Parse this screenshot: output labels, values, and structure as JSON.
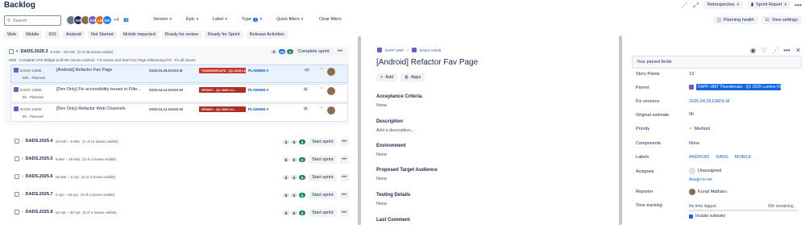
{
  "header": {
    "title": "Backlog",
    "retrospective": "Retrospective",
    "sprint_report": "Sprint Report"
  },
  "filters": {
    "search_placeholder": "Search",
    "avatars": [
      {
        "initials": "",
        "color": "#6b778c"
      },
      {
        "initials": "DS",
        "color": "#1d2b4f"
      },
      {
        "initials": "",
        "color": "#8c6b4f"
      },
      {
        "initials": "KG",
        "color": "#6e5dc6"
      },
      {
        "initials": "LN",
        "color": "#e56910"
      },
      {
        "initials": "MS",
        "color": "#1d7afc"
      }
    ],
    "avatars_more": "+4",
    "version": "Version",
    "epic": "Epic",
    "label": "Label",
    "type": "Type",
    "type_count": "1",
    "quick_filters": "Quick filters",
    "clear_filters": "Clear filters",
    "planning_health": "Planning health",
    "view_settings": "View settings"
  },
  "chips": [
    "Web",
    "Mobile",
    "IOS",
    "Android",
    "Not Started",
    "Mobile impacted",
    "Ready for review",
    "Ready for Sprint",
    "Release Activities"
  ],
  "active_sprint": {
    "name": "DADS.2025.3",
    "dates": "5 Feb – 19 Feb",
    "visible": "(3 of 36 issues visible)",
    "counts": [
      "0",
      "26",
      "0"
    ],
    "complete_label": "Complete sprint",
    "goal": "Web - Complete LPS Widget & all WA issues Android - Fix Issues and Start Fav Page refactoring iOS - Fix all issues",
    "issues": [
      {
        "key": "DADS-14036",
        "summary": "[Android] Refactor Fav Page",
        "estimate": "60h - Planned",
        "fix": "2025.04.28.DADS.M",
        "epic": "THUNDERCATS - Q1 2025 LU...",
        "epic_color": "#c9372c",
        "status": "PLANNED",
        "points": "13"
      },
      {
        "key": "DADS-13958",
        "summary": "[Dev Only] Fix accessibility issues in Filte...",
        "estimate": "8h - Planned",
        "fix": "2025.04.13.DADS.W",
        "epic": "SPIDEY - Q1 2025 LU...",
        "epic_color": "#ae2e24",
        "status": "PLANNED",
        "points": "8"
      },
      {
        "key": "DADS-14046",
        "summary": "[Dev Only] Refactor Web Channels",
        "estimate": "8h - Planned",
        "fix": "2025.04.13.DADS.W",
        "epic": "SPIDEY - Q1 2025 LU...",
        "epic_color": "#ae2e24",
        "status": "PLANNED",
        "points": "8"
      }
    ]
  },
  "sprints": [
    {
      "name": "DADS.2025.4",
      "dates": "19 Feb – 5 Mar",
      "visible": "(1 of 13 issues visible)",
      "counts": [
        "3",
        "0",
        "0"
      ],
      "action": "Start sprint"
    },
    {
      "name": "DADS.2025.5",
      "dates": "5 Mar – 19 Mar",
      "visible": "(0 of 4 issues visible)",
      "counts": [
        "0",
        "0",
        "0"
      ],
      "action": "Start sprint"
    },
    {
      "name": "DADS.2025.6",
      "dates": "19 Mar – 2 Apr",
      "visible": "(0 of 4 issues visible)",
      "counts": [
        "0",
        "0",
        "0"
      ],
      "action": "Start sprint"
    },
    {
      "name": "DADS.2025.7",
      "dates": "2 Apr – 16 Apr",
      "visible": "(0 of 4 issues visible)",
      "counts": [
        "0",
        "0",
        "0"
      ],
      "action": "Start sprint"
    },
    {
      "name": "DADS.2025.8",
      "dates": "16 Apr – 30 Apr",
      "visible": "(0 of 4 issues visible)",
      "counts": [
        "0",
        "0",
        "0"
      ],
      "action": "Start sprint"
    }
  ],
  "detail": {
    "crumb1": "DAPF-1897",
    "crumb2": "DADS-14036",
    "title": "[Android] Refactor Fav Page",
    "add": "Add",
    "apps": "Apps",
    "sections": [
      {
        "label": "Acceptance Criteria.",
        "value": "None"
      },
      {
        "label": "Description",
        "value": "Add a description..."
      },
      {
        "label": "Environment",
        "value": "None"
      },
      {
        "label": "Proposed Target Audience",
        "value": "None"
      },
      {
        "label": "Testing Details",
        "value": "None"
      },
      {
        "label": "Last Comment",
        "value": ""
      }
    ]
  },
  "fields": {
    "pinned": "Your pinned fields",
    "story_points_label": "Story Points",
    "story_points": "13",
    "parent_label": "Parent",
    "parent": "DAPF-1897 Thundercats - Q1 2025 Lumino He...",
    "fix_label": "Fix versions",
    "fix": "2025.04.28.DADS.M",
    "orig_label": "Original estimate",
    "orig": "0h",
    "priority_label": "Priority",
    "priority": "Medium",
    "components_label": "Components",
    "components": "None",
    "labels_label": "Labels",
    "labels": [
      "ANDROID",
      "DADS",
      "MOBILE"
    ],
    "assignee_label": "Assignee",
    "assignee": "Unassigned",
    "assign_to_me": "Assign to me",
    "reporter_label": "Reporter",
    "reporter": "Kunal Matharu",
    "time_label": "Time tracking",
    "time_logged": "No time logged",
    "time_remaining": "60h remaining",
    "include_subtasks": "Include subtasks"
  }
}
